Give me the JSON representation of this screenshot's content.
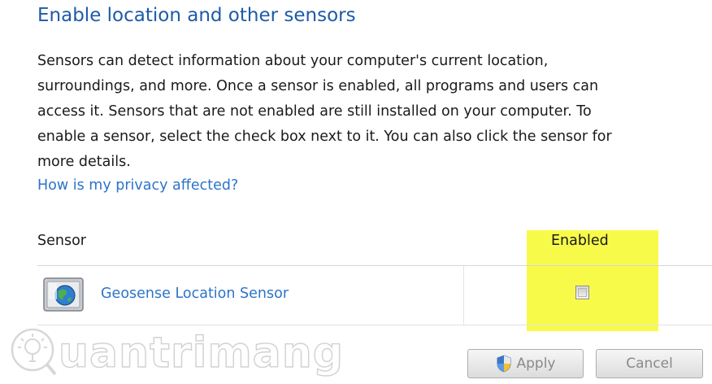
{
  "header": {
    "title": "Enable location and other sensors"
  },
  "description": {
    "lines": [
      "Sensors can detect information about your computer's current location,",
      "surroundings, and more. Once a sensor is enabled, all programs and users can",
      "access it. Sensors that are not enabled are still installed on your computer. To",
      "enable a sensor, select the check box next to it. You can also click the sensor for",
      "more details."
    ]
  },
  "privacy_link": "How is my privacy affected?",
  "table": {
    "columns": {
      "sensor": "Sensor",
      "enabled": "Enabled"
    },
    "rows": [
      {
        "name": "Geosense Location Sensor",
        "icon": "location-sensor-icon",
        "enabled": false
      }
    ]
  },
  "buttons": {
    "apply": "Apply",
    "cancel": "Cancel"
  },
  "watermark": {
    "text": "uantrimang"
  },
  "colors": {
    "title": "#1e5aa8",
    "link": "#2c74c9",
    "highlight": "#f7f92a"
  }
}
